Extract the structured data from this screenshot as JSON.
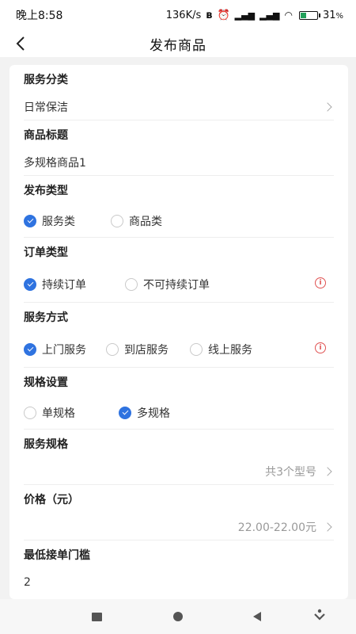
{
  "status_bar": {
    "time": "晚上8:58",
    "network_speed": "136K/s",
    "signal1": "ᯤ",
    "battery": "31",
    "battery_unit": "%"
  },
  "nav": {
    "title": "发布商品"
  },
  "form": {
    "service_category": {
      "label": "服务分类",
      "value": "日常保洁"
    },
    "product_title": {
      "label": "商品标题",
      "value": "多规格商品1"
    },
    "publish_type": {
      "label": "发布类型",
      "options": [
        "服务类",
        "商品类"
      ],
      "selected": 0
    },
    "order_type": {
      "label": "订单类型",
      "options": [
        "持续订单",
        "不可持续订单"
      ],
      "selected": 0
    },
    "service_mode": {
      "label": "服务方式",
      "options": [
        "上门服务",
        "到店服务",
        "线上服务"
      ],
      "selected": 0
    },
    "spec_setting": {
      "label": "规格设置",
      "options": [
        "单规格",
        "多规格"
      ],
      "selected": 1
    },
    "service_spec": {
      "label": "服务规格",
      "value": "共3个型号"
    },
    "price": {
      "label": "价格（元）",
      "value": "22.00-22.00元"
    },
    "min_order": {
      "label": "最低接单门槛",
      "value": "2"
    }
  },
  "colors": {
    "accent": "#2f73e0",
    "warning": "#e05252"
  }
}
